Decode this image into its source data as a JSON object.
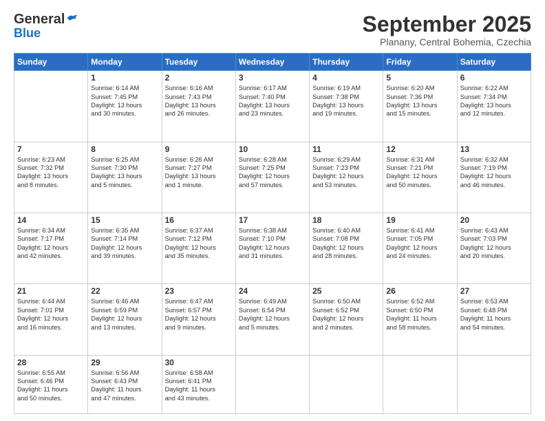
{
  "logo": {
    "general": "General",
    "blue": "Blue"
  },
  "title": "September 2025",
  "subtitle": "Planany, Central Bohemia, Czechia",
  "weekdays": [
    "Sunday",
    "Monday",
    "Tuesday",
    "Wednesday",
    "Thursday",
    "Friday",
    "Saturday"
  ],
  "weeks": [
    [
      {
        "day": "",
        "text": ""
      },
      {
        "day": "1",
        "text": "Sunrise: 6:14 AM\nSunset: 7:45 PM\nDaylight: 13 hours\nand 30 minutes."
      },
      {
        "day": "2",
        "text": "Sunrise: 6:16 AM\nSunset: 7:43 PM\nDaylight: 13 hours\nand 26 minutes."
      },
      {
        "day": "3",
        "text": "Sunrise: 6:17 AM\nSunset: 7:40 PM\nDaylight: 13 hours\nand 23 minutes."
      },
      {
        "day": "4",
        "text": "Sunrise: 6:19 AM\nSunset: 7:38 PM\nDaylight: 13 hours\nand 19 minutes."
      },
      {
        "day": "5",
        "text": "Sunrise: 6:20 AM\nSunset: 7:36 PM\nDaylight: 13 hours\nand 15 minutes."
      },
      {
        "day": "6",
        "text": "Sunrise: 6:22 AM\nSunset: 7:34 PM\nDaylight: 13 hours\nand 12 minutes."
      }
    ],
    [
      {
        "day": "7",
        "text": "Sunrise: 6:23 AM\nSunset: 7:32 PM\nDaylight: 13 hours\nand 8 minutes."
      },
      {
        "day": "8",
        "text": "Sunrise: 6:25 AM\nSunset: 7:30 PM\nDaylight: 13 hours\nand 5 minutes."
      },
      {
        "day": "9",
        "text": "Sunrise: 6:26 AM\nSunset: 7:27 PM\nDaylight: 13 hours\nand 1 minute."
      },
      {
        "day": "10",
        "text": "Sunrise: 6:28 AM\nSunset: 7:25 PM\nDaylight: 12 hours\nand 57 minutes."
      },
      {
        "day": "11",
        "text": "Sunrise: 6:29 AM\nSunset: 7:23 PM\nDaylight: 12 hours\nand 53 minutes."
      },
      {
        "day": "12",
        "text": "Sunrise: 6:31 AM\nSunset: 7:21 PM\nDaylight: 12 hours\nand 50 minutes."
      },
      {
        "day": "13",
        "text": "Sunrise: 6:32 AM\nSunset: 7:19 PM\nDaylight: 12 hours\nand 46 minutes."
      }
    ],
    [
      {
        "day": "14",
        "text": "Sunrise: 6:34 AM\nSunset: 7:17 PM\nDaylight: 12 hours\nand 42 minutes."
      },
      {
        "day": "15",
        "text": "Sunrise: 6:35 AM\nSunset: 7:14 PM\nDaylight: 12 hours\nand 39 minutes."
      },
      {
        "day": "16",
        "text": "Sunrise: 6:37 AM\nSunset: 7:12 PM\nDaylight: 12 hours\nand 35 minutes."
      },
      {
        "day": "17",
        "text": "Sunrise: 6:38 AM\nSunset: 7:10 PM\nDaylight: 12 hours\nand 31 minutes."
      },
      {
        "day": "18",
        "text": "Sunrise: 6:40 AM\nSunset: 7:08 PM\nDaylight: 12 hours\nand 28 minutes."
      },
      {
        "day": "19",
        "text": "Sunrise: 6:41 AM\nSunset: 7:05 PM\nDaylight: 12 hours\nand 24 minutes."
      },
      {
        "day": "20",
        "text": "Sunrise: 6:43 AM\nSunset: 7:03 PM\nDaylight: 12 hours\nand 20 minutes."
      }
    ],
    [
      {
        "day": "21",
        "text": "Sunrise: 6:44 AM\nSunset: 7:01 PM\nDaylight: 12 hours\nand 16 minutes."
      },
      {
        "day": "22",
        "text": "Sunrise: 6:46 AM\nSunset: 6:59 PM\nDaylight: 12 hours\nand 13 minutes."
      },
      {
        "day": "23",
        "text": "Sunrise: 6:47 AM\nSunset: 6:57 PM\nDaylight: 12 hours\nand 9 minutes."
      },
      {
        "day": "24",
        "text": "Sunrise: 6:49 AM\nSunset: 6:54 PM\nDaylight: 12 hours\nand 5 minutes."
      },
      {
        "day": "25",
        "text": "Sunrise: 6:50 AM\nSunset: 6:52 PM\nDaylight: 12 hours\nand 2 minutes."
      },
      {
        "day": "26",
        "text": "Sunrise: 6:52 AM\nSunset: 6:50 PM\nDaylight: 11 hours\nand 58 minutes."
      },
      {
        "day": "27",
        "text": "Sunrise: 6:53 AM\nSunset: 6:48 PM\nDaylight: 11 hours\nand 54 minutes."
      }
    ],
    [
      {
        "day": "28",
        "text": "Sunrise: 6:55 AM\nSunset: 6:46 PM\nDaylight: 11 hours\nand 50 minutes."
      },
      {
        "day": "29",
        "text": "Sunrise: 6:56 AM\nSunset: 6:43 PM\nDaylight: 11 hours\nand 47 minutes."
      },
      {
        "day": "30",
        "text": "Sunrise: 6:58 AM\nSunset: 6:41 PM\nDaylight: 11 hours\nand 43 minutes."
      },
      {
        "day": "",
        "text": ""
      },
      {
        "day": "",
        "text": ""
      },
      {
        "day": "",
        "text": ""
      },
      {
        "day": "",
        "text": ""
      }
    ]
  ]
}
